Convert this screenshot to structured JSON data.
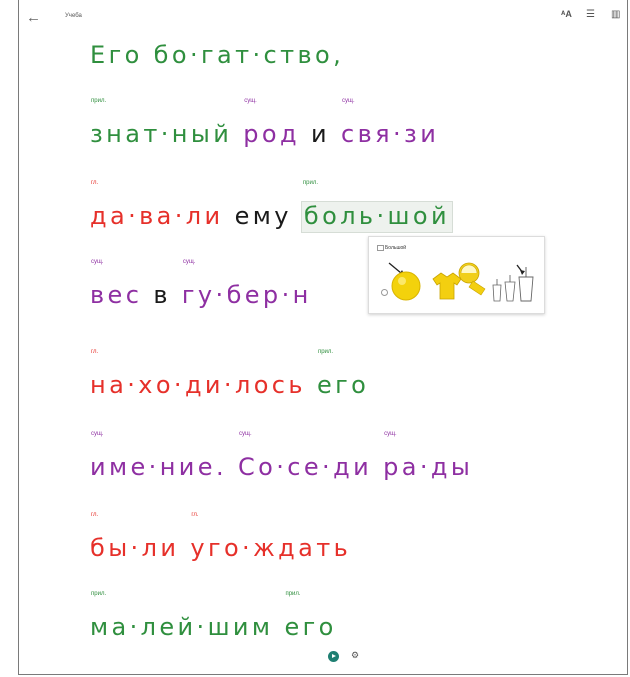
{
  "app": {
    "title": "Учеба"
  },
  "toolbar": {
    "back_icon": "←",
    "translate_icon": "ᴬA",
    "menu_icon": "☰",
    "book_icon": "▥"
  },
  "text": {
    "line1": {
      "w1": "Его бо·гат·ство,"
    },
    "line2": {
      "t1": "прил.",
      "w1": "знат·ный",
      "t2": "сущ.",
      "w2": "род",
      "w3": "и",
      "t4": "сущ.",
      "w4": "свя·зи"
    },
    "line3": {
      "t1": "гл.",
      "w1": "да·ва·ли",
      "w2": "ему",
      "t3": "прил.",
      "w3": "боль·шой"
    },
    "line4": {
      "t1": "сущ.",
      "w1": "вес",
      "w2": "в",
      "t3": "сущ.",
      "w3": "гу·бер·н"
    },
    "line5": {
      "t1": "гл.",
      "w1": "на·хо·ди·лось",
      "t2": "прил.",
      "w2": "его"
    },
    "line6": {
      "t1": "сущ.",
      "w1": "име·ние.",
      "t2": "сущ.",
      "w2": "Со·се·ди",
      "t3": "сущ.",
      "w3": "ра·ды"
    },
    "line7": {
      "t1": "гл.",
      "w1": "бы·ли",
      "t2": "гл.",
      "w2": "уго·ждать"
    },
    "line8": {
      "t1": "прил.",
      "w1": "ма·лей·шим",
      "t2": "прил.",
      "w2": "его"
    }
  },
  "popup": {
    "title": "Большой"
  },
  "bottom": {
    "play_icon": "play-icon",
    "settings_icon": "⚙"
  },
  "colors": {
    "noun": "#8e2fa2",
    "verb": "#e6302a",
    "adj": "#2f8f3e",
    "accent": "#1f7f72"
  }
}
